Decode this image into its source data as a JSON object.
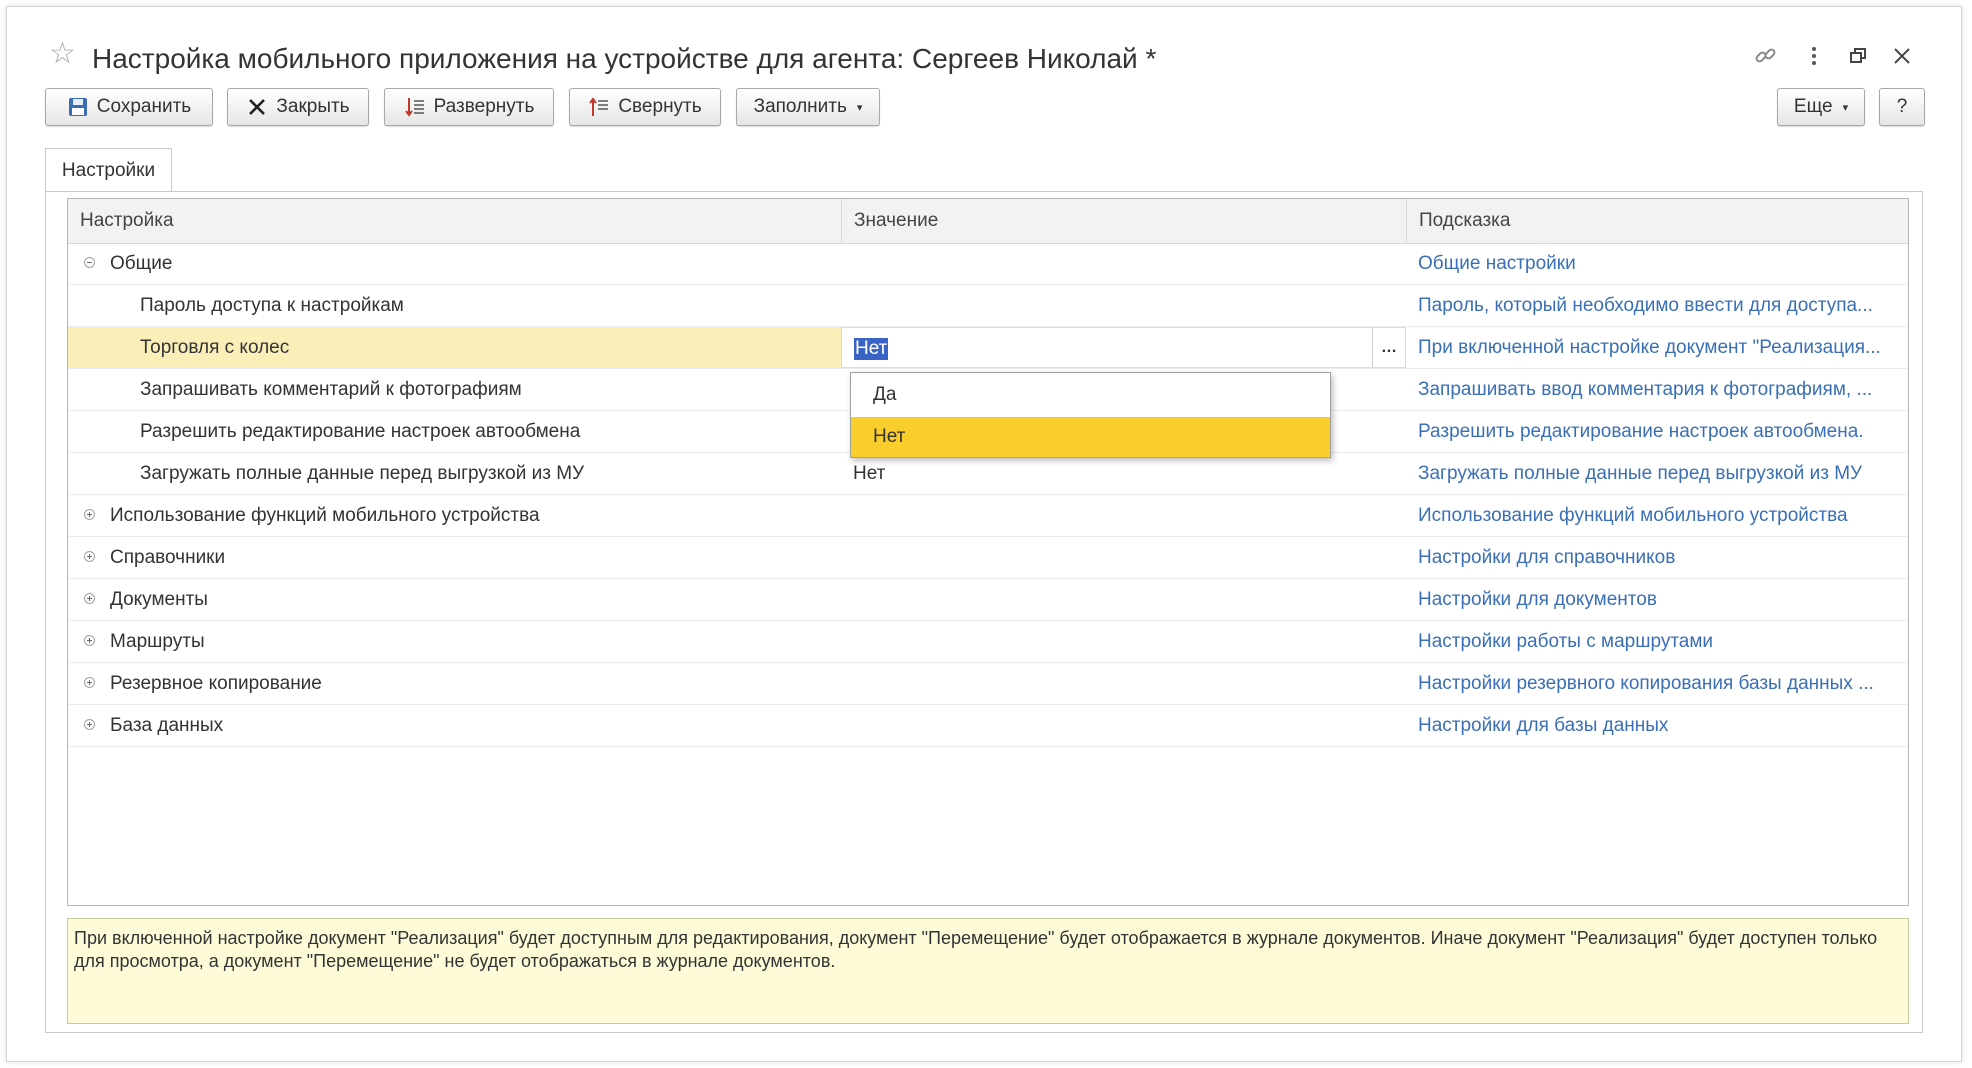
{
  "window": {
    "title": "Настройка мобильного приложения на устройстве для агента: Сергеев Николай *"
  },
  "toolbar": {
    "save_label": "Сохранить",
    "close_label": "Закрыть",
    "expand_label": "Развернуть",
    "collapse_label": "Свернуть",
    "fill_label": "Заполнить",
    "more_label": "Еще",
    "help_label": "?"
  },
  "tabs": [
    {
      "label": "Настройки"
    }
  ],
  "grid": {
    "columns": [
      "Настройка",
      "Значение",
      "Подсказка"
    ],
    "rows": [
      {
        "setting": "Общие",
        "value": "",
        "hint": "Общие настройки",
        "level": 0,
        "expander": "minus"
      },
      {
        "setting": "Пароль доступа к настройкам",
        "value": "",
        "hint": "Пароль, который необходимо ввести для доступа...",
        "level": 1
      },
      {
        "setting": "Торговля с колес",
        "value": "Нет",
        "hint": "При включенной настройке документ \"Реализация...",
        "level": 1,
        "selected": true
      },
      {
        "setting": "Запрашивать комментарий к фотографиям",
        "value": "",
        "hint": "Запрашивать ввод комментария к фотографиям, ...",
        "level": 1
      },
      {
        "setting": "Разрешить редактирование настроек автообмена",
        "value": "",
        "hint": "Разрешить редактирование настроек автообмена.",
        "level": 1
      },
      {
        "setting": "Загружать полные данные перед выгрузкой из МУ",
        "value": "Нет",
        "hint": "Загружать полные данные перед выгрузкой из МУ",
        "level": 1
      },
      {
        "setting": "Использование функций мобильного устройства",
        "value": "",
        "hint": "Использование функций мобильного устройства",
        "level": 0,
        "expander": "plus"
      },
      {
        "setting": "Справочники",
        "value": "",
        "hint": "Настройки для справочников",
        "level": 0,
        "expander": "plus"
      },
      {
        "setting": "Документы",
        "value": "",
        "hint": "Настройки для документов",
        "level": 0,
        "expander": "plus"
      },
      {
        "setting": "Маршруты",
        "value": "",
        "hint": "Настройки работы с маршрутами",
        "level": 0,
        "expander": "plus"
      },
      {
        "setting": "Резервное копирование",
        "value": "",
        "hint": "Настройки резервного копирования базы данных ...",
        "level": 0,
        "expander": "plus"
      },
      {
        "setting": "База данных",
        "value": "",
        "hint": "Настройки для базы данных",
        "level": 0,
        "expander": "plus"
      }
    ]
  },
  "dropdown": {
    "options": [
      "Да",
      "Нет"
    ],
    "selected": "Нет"
  },
  "hint_panel": {
    "text": "При включенной настройке документ \"Реализация\" будет доступным для редактирования, документ \"Перемещение\" будет отображается в журнале документов. Иначе документ \"Реализация\" будет доступен только для просмотра, а документ \"Перемещение\" не будет отображаться в журнале документов."
  },
  "colors": {
    "selected_row": "#fbefb9",
    "dropdown_active": "#f9cd2c",
    "hint_link": "#3a6fb7",
    "hint_panel_bg": "#fefbd8"
  }
}
